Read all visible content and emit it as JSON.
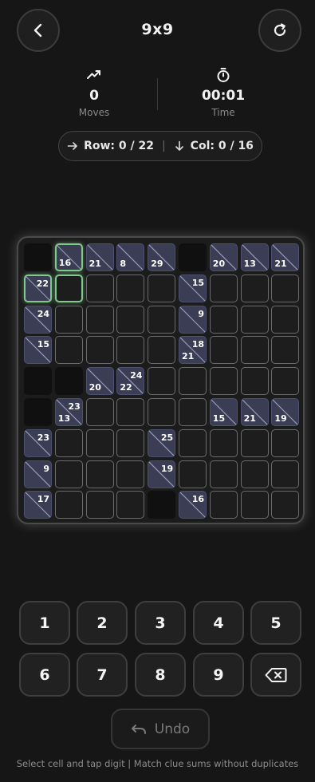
{
  "header": {
    "title": "9x9",
    "back_icon": "chevron-left-icon",
    "restart_icon": "refresh-icon"
  },
  "stats": {
    "moves": {
      "value": "0",
      "label": "Moves",
      "icon": "trending-up-icon"
    },
    "time": {
      "value": "00:01",
      "label": "Time",
      "icon": "stopwatch-icon"
    }
  },
  "progress": {
    "row_text": "Row: 0 / 22",
    "col_text": "Col: 0 / 16",
    "row_icon": "arrow-right-icon",
    "col_icon": "arrow-down-icon"
  },
  "board": {
    "size": 9,
    "grid": [
      [
        {
          "t": "b"
        },
        {
          "t": "c",
          "d": "16",
          "sel": true
        },
        {
          "t": "c",
          "d": "21"
        },
        {
          "t": "c",
          "d": "8"
        },
        {
          "t": "c",
          "d": "29"
        },
        {
          "t": "b"
        },
        {
          "t": "c",
          "d": "20"
        },
        {
          "t": "c",
          "d": "13"
        },
        {
          "t": "c",
          "d": "21"
        }
      ],
      [
        {
          "t": "c",
          "a": "22",
          "sel": true
        },
        {
          "t": "i",
          "sel": true
        },
        {
          "t": "i"
        },
        {
          "t": "i"
        },
        {
          "t": "i"
        },
        {
          "t": "c",
          "a": "15"
        },
        {
          "t": "i"
        },
        {
          "t": "i"
        },
        {
          "t": "i"
        }
      ],
      [
        {
          "t": "c",
          "a": "24"
        },
        {
          "t": "i"
        },
        {
          "t": "i"
        },
        {
          "t": "i"
        },
        {
          "t": "i"
        },
        {
          "t": "c",
          "a": "9"
        },
        {
          "t": "i"
        },
        {
          "t": "i"
        },
        {
          "t": "i"
        }
      ],
      [
        {
          "t": "c",
          "a": "15"
        },
        {
          "t": "i"
        },
        {
          "t": "i"
        },
        {
          "t": "i"
        },
        {
          "t": "i"
        },
        {
          "t": "c",
          "a": "18",
          "d": "21"
        },
        {
          "t": "i"
        },
        {
          "t": "i"
        },
        {
          "t": "i"
        }
      ],
      [
        {
          "t": "b"
        },
        {
          "t": "b"
        },
        {
          "t": "c",
          "d": "20"
        },
        {
          "t": "c",
          "a": "24",
          "d": "22"
        },
        {
          "t": "i"
        },
        {
          "t": "i"
        },
        {
          "t": "i"
        },
        {
          "t": "i"
        },
        {
          "t": "i"
        }
      ],
      [
        {
          "t": "b"
        },
        {
          "t": "c",
          "a": "23",
          "d": "13"
        },
        {
          "t": "i"
        },
        {
          "t": "i"
        },
        {
          "t": "i"
        },
        {
          "t": "i"
        },
        {
          "t": "c",
          "d": "15"
        },
        {
          "t": "c",
          "d": "21"
        },
        {
          "t": "c",
          "d": "19"
        }
      ],
      [
        {
          "t": "c",
          "a": "23"
        },
        {
          "t": "i"
        },
        {
          "t": "i"
        },
        {
          "t": "i"
        },
        {
          "t": "c",
          "a": "25"
        },
        {
          "t": "i"
        },
        {
          "t": "i"
        },
        {
          "t": "i"
        },
        {
          "t": "i"
        }
      ],
      [
        {
          "t": "c",
          "a": "9"
        },
        {
          "t": "i"
        },
        {
          "t": "i"
        },
        {
          "t": "i"
        },
        {
          "t": "c",
          "a": "19"
        },
        {
          "t": "i"
        },
        {
          "t": "i"
        },
        {
          "t": "i"
        },
        {
          "t": "i"
        }
      ],
      [
        {
          "t": "c",
          "a": "17"
        },
        {
          "t": "i"
        },
        {
          "t": "i"
        },
        {
          "t": "i"
        },
        {
          "t": "b"
        },
        {
          "t": "c",
          "a": "16"
        },
        {
          "t": "i"
        },
        {
          "t": "i"
        },
        {
          "t": "i"
        }
      ]
    ]
  },
  "keypad": {
    "keys": [
      "1",
      "2",
      "3",
      "4",
      "5",
      "6",
      "7",
      "8",
      "9"
    ],
    "backspace_icon": "backspace-icon"
  },
  "undo": {
    "label": "Undo",
    "icon": "undo-icon"
  },
  "hint": "Select cell and tap digit  |  Match clue sums without duplicates",
  "colors": {
    "background": "#161616",
    "clue_cell": "#3b3d55",
    "selection": "#7fc98c"
  }
}
